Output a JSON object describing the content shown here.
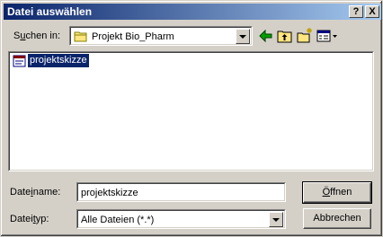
{
  "window": {
    "title": "Datei auswählen",
    "help_glyph": "?",
    "close_glyph": "X"
  },
  "look_in": {
    "label_pre": "S",
    "label_mnemonic": "u",
    "label_post": "chen in:",
    "value": "Projekt Bio_Pharm",
    "icon": "folder-icon"
  },
  "toolbar": {
    "back_icon": "back-arrow-icon",
    "up_icon": "up-one-level-icon",
    "new_folder_icon": "new-folder-icon",
    "view_icon": "view-menu-icon"
  },
  "files": [
    {
      "name": "projektskizze",
      "icon": "document-icon",
      "selected": true
    }
  ],
  "filename": {
    "label_pre": "Date",
    "label_mnemonic": "i",
    "label_post": "name:",
    "value": "projektskizze"
  },
  "filetype": {
    "label_pre": "Datei",
    "label_mnemonic": "t",
    "label_post": "yp:",
    "value": "Alle Dateien (*.*)"
  },
  "buttons": {
    "open_mnemonic": "Ö",
    "open_rest": "ffnen",
    "cancel": "Abbrechen"
  },
  "colors": {
    "title_start": "#0a246a",
    "title_end": "#a6caf0",
    "selection": "#0a246a",
    "face": "#d4d0c8"
  }
}
